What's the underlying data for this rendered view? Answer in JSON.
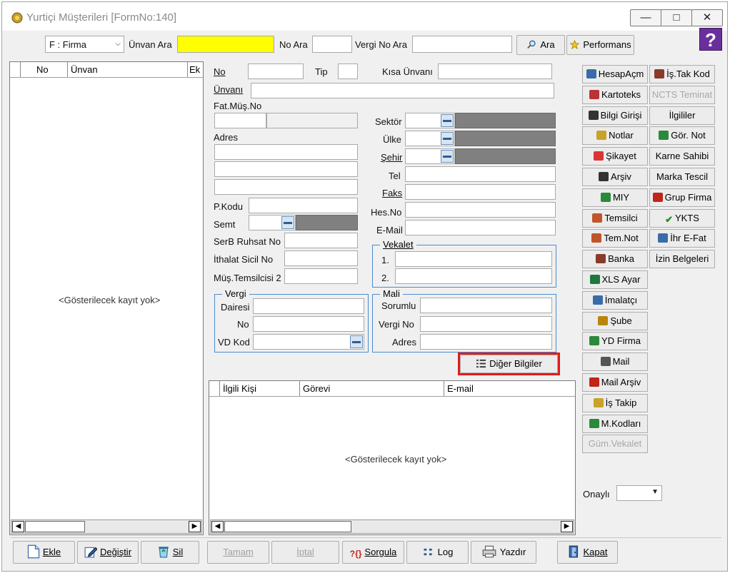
{
  "window": {
    "title": "Yurtiçi Müşterileri [FormNo:140]",
    "minimize": "—",
    "maximize": "□",
    "close": "✕",
    "help": "?"
  },
  "search_bar": {
    "type_combo": "F : Firma",
    "unvan_ara": "Ünvan Ara",
    "no_ara": "No Ara",
    "vergi_no_ara": "Vergi No Ara",
    "ara_button": "Ara",
    "performans_button": "Performans",
    "accent_yellow": "#ffff00"
  },
  "left_grid": {
    "columns": [
      "No",
      "Ünvan",
      "Ek"
    ],
    "empty_text": "<Gösterilecek kayıt yok>"
  },
  "form": {
    "no": "No",
    "tip": "Tip",
    "kisa_unvan": "Kısa Ünvanı",
    "unvani": "Ünvanı",
    "fat_mus_no": "Fat.Müş.No",
    "adres": "Adres",
    "p_kodu": "P.Kodu",
    "semt": "Semt",
    "serb_ruhsat_no": "SerB Ruhsat No",
    "ithalat_sicil_no": "İthalat Sicil No",
    "mus_temsilcisi2": "Müş.Temsilcisi 2",
    "sektor": "Sektör",
    "ulke": "Ülke",
    "sehir": "Şehir",
    "tel": "Tel",
    "faks": "Faks",
    "hes_no": "Hes.No",
    "email": "E-Mail",
    "vekalet": {
      "title": "Vekalet",
      "row1": "1.",
      "row2": "2."
    },
    "vergi": {
      "title": "Vergi",
      "dairesi": "Dairesi",
      "no": "No",
      "vd_kod": "VD Kod"
    },
    "mali": {
      "title": "Mali",
      "sorumlu": "Sorumlu",
      "vergi_no": "Vergi No",
      "adres": "Adres"
    },
    "diger_bilgiler": "Diğer Bilgiler"
  },
  "contacts_grid": {
    "columns": [
      "İlgili Kişi",
      "Görevi",
      "E-mail"
    ],
    "empty_text": "<Gösterilecek kayıt yok>"
  },
  "right_buttons": {
    "col1": [
      {
        "label": "HesapAçm",
        "icon": "link-icon",
        "disabled": false
      },
      {
        "label": "Kartoteks",
        "icon": "cards-icon",
        "disabled": false
      },
      {
        "label": "Bilgi Girişi",
        "icon": "document-icon",
        "disabled": false
      },
      {
        "label": "Notlar",
        "icon": "notes-icon",
        "disabled": false
      },
      {
        "label": "Şikayet",
        "icon": "complaint-icon",
        "disabled": false
      },
      {
        "label": "Arşiv",
        "icon": "archive-search-icon",
        "disabled": false
      },
      {
        "label": "MIY",
        "icon": "globe-icon",
        "disabled": false
      },
      {
        "label": "Temsilci",
        "icon": "people-icon",
        "disabled": false
      },
      {
        "label": "Tem.Not",
        "icon": "people-icon",
        "disabled": false
      },
      {
        "label": "Banka",
        "icon": "bank-icon",
        "disabled": false
      },
      {
        "label": "XLS Ayar",
        "icon": "excel-icon",
        "disabled": false
      },
      {
        "label": "İmalatçı",
        "icon": "factory-icon",
        "disabled": false
      },
      {
        "label": "Şube",
        "icon": "branch-icon",
        "disabled": false
      },
      {
        "label": "YD Firma",
        "icon": "foreign-company-icon",
        "disabled": false
      },
      {
        "label": "Mail",
        "icon": "mail-icon",
        "disabled": false
      },
      {
        "label": "Mail Arşiv",
        "icon": "mailbox-icon",
        "disabled": false
      },
      {
        "label": "İş Takip",
        "icon": "task-icon",
        "disabled": false
      },
      {
        "label": "M.Kodları",
        "icon": "book-icon",
        "disabled": false
      },
      {
        "label": "Güm.Vekalet",
        "icon": "",
        "disabled": true
      }
    ],
    "col2": [
      {
        "label": "İş.Tak Kod",
        "icon": "code-icon",
        "disabled": false
      },
      {
        "label": "NCTS Teminat",
        "icon": "",
        "disabled": true
      },
      {
        "label": "İlgililer",
        "icon": "",
        "disabled": false
      },
      {
        "label": "Gör. Not",
        "icon": "note-view-icon",
        "disabled": false
      },
      {
        "label": "Karne Sahibi",
        "icon": "",
        "disabled": false
      },
      {
        "label": "Marka Tescil",
        "icon": "",
        "disabled": false
      },
      {
        "label": "Grup Firma",
        "icon": "group-icon",
        "disabled": false
      },
      {
        "label": "YKTS",
        "icon": "check-icon",
        "disabled": false
      },
      {
        "label": "İhr E-Fat",
        "icon": "invoice-icon",
        "disabled": false
      },
      {
        "label": "İzin Belgeleri",
        "icon": "",
        "disabled": false
      }
    ],
    "onayli": "Onaylı"
  },
  "bottom_bar": {
    "ekle": "Ekle",
    "degistir": "Değiştir",
    "sil": "Sil",
    "tamam": "Tamam",
    "iptal": "İptal",
    "sorgula": "Sorgula",
    "log": "Log",
    "yazdir": "Yazdır",
    "kapat": "Kapat"
  }
}
